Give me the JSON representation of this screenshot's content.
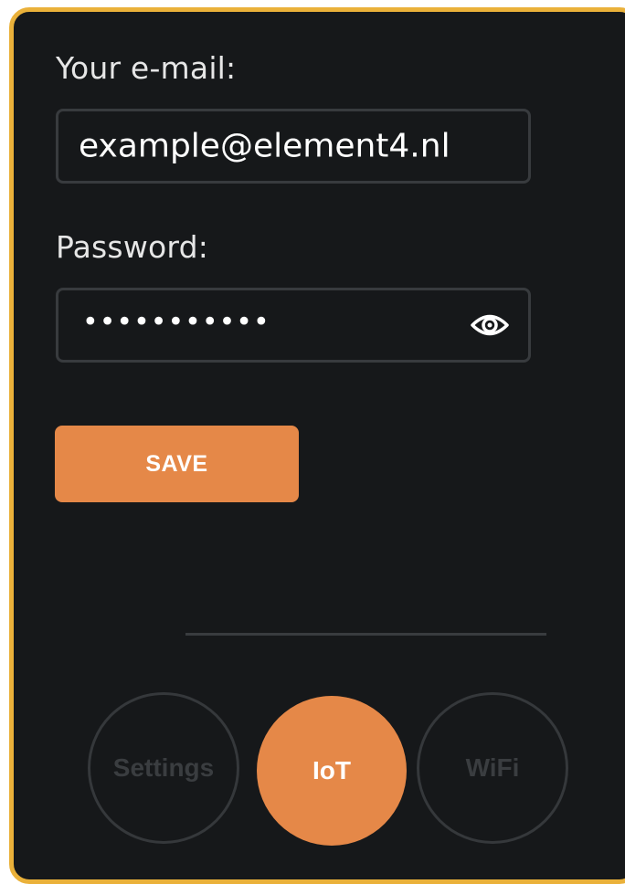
{
  "form": {
    "email_label": "Your e-mail:",
    "email_value": "example@element4.nl",
    "password_label": "Password:",
    "password_masked": "•••••••••••",
    "save_label": "SAVE"
  },
  "nav": {
    "items": [
      {
        "label": "Settings",
        "active": false
      },
      {
        "label": "IoT",
        "active": true
      },
      {
        "label": "WiFi",
        "active": false
      }
    ]
  },
  "colors": {
    "frame_border": "#eab13a",
    "background": "#16181a",
    "accent": "#e58848",
    "field_border": "#383b3e",
    "inactive_text": "#3a3d40"
  },
  "icons": {
    "password_toggle": "eye-icon"
  }
}
